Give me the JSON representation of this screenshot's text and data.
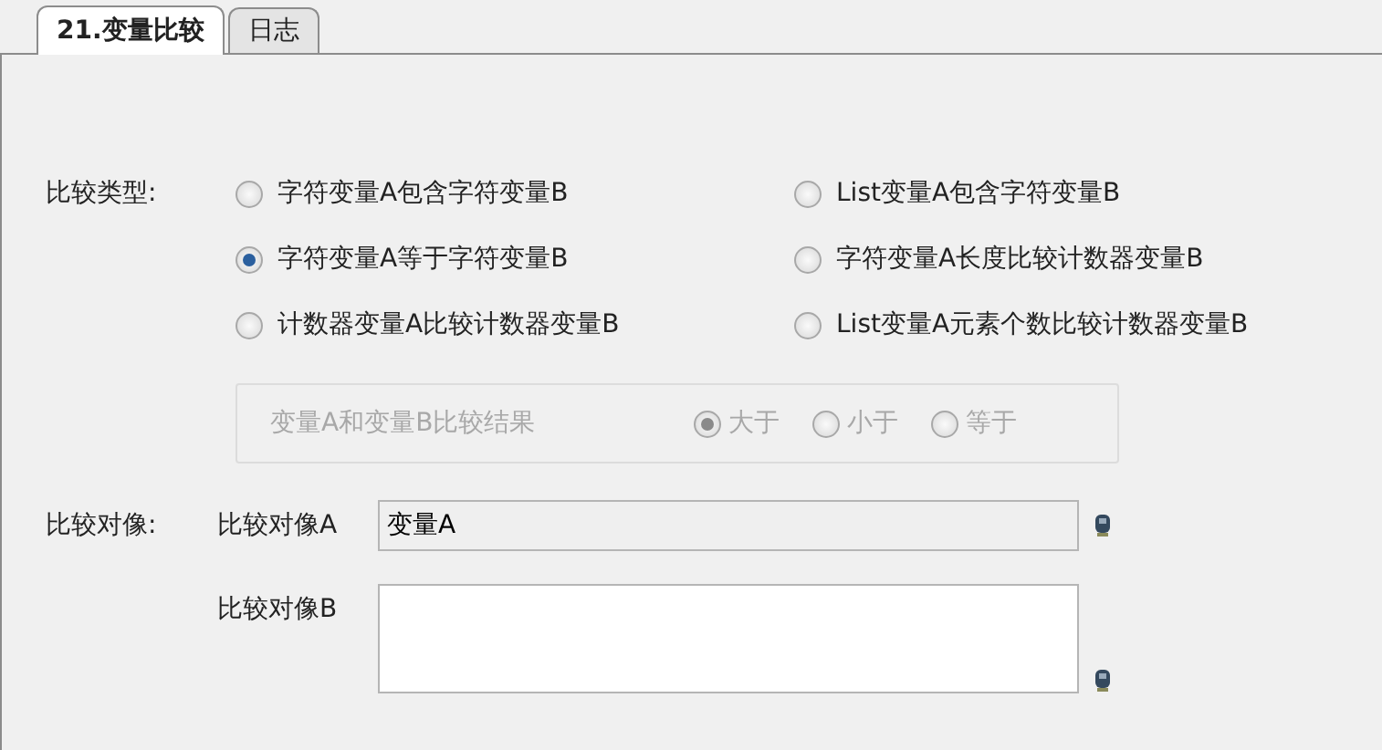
{
  "tabs": [
    {
      "label": "21.变量比较",
      "selected": true
    },
    {
      "label": "日志",
      "selected": false
    }
  ],
  "compare_type": {
    "label": "比较类型:",
    "options": [
      {
        "label": "字符变量A包含字符变量B",
        "selected": false
      },
      {
        "label": "List变量A包含字符变量B",
        "selected": false
      },
      {
        "label": "字符变量A等于字符变量B",
        "selected": true
      },
      {
        "label": "字符变量A长度比较计数器变量B",
        "selected": false
      },
      {
        "label": "计数器变量A比较计数器变量B",
        "selected": false
      },
      {
        "label": "List变量A元素个数比较计数器变量B",
        "selected": false
      }
    ]
  },
  "result_group": {
    "label": "变量A和变量B比较结果",
    "disabled": true,
    "options": [
      {
        "label": "大于",
        "selected": true
      },
      {
        "label": "小于",
        "selected": false
      },
      {
        "label": "等于",
        "selected": false
      }
    ]
  },
  "compare_object": {
    "label": "比较对像:",
    "fields": [
      {
        "label": "比较对像A",
        "value": "变量A",
        "readonly": true,
        "kind": "line"
      },
      {
        "label": "比较对像B",
        "readonly": false,
        "kind": "box"
      }
    ]
  }
}
